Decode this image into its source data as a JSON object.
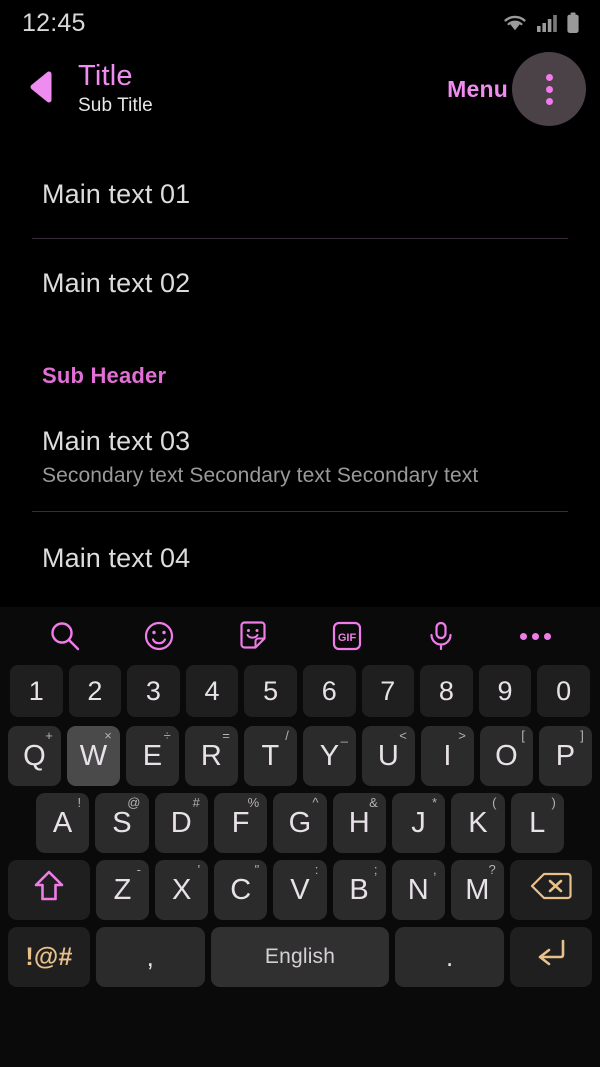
{
  "status_bar": {
    "time": "12:45",
    "icons": [
      "wifi-icon",
      "signal-icon",
      "battery-icon"
    ]
  },
  "app_bar": {
    "back_icon": "back-chevron-icon",
    "title": "Title",
    "subtitle": "Sub Title",
    "menu_label": "Menu",
    "overflow_icon": "overflow-menu-icon",
    "accent_color": "#ef8cef"
  },
  "content": {
    "rows": [
      {
        "main": "Main text 01",
        "secondary": ""
      },
      {
        "main": "Main text 02",
        "secondary": ""
      },
      {
        "main": "Main text 03",
        "secondary": "Secondary text Secondary text Secondary text"
      },
      {
        "main": "Main text 04",
        "secondary": ""
      }
    ],
    "sub_header": "Sub Header",
    "sub_header_color": "#e26fd6",
    "divider_color": "#3a2b3a"
  },
  "keyboard": {
    "toolbar": [
      {
        "name": "search-icon",
        "label": "Search"
      },
      {
        "name": "emoji-icon",
        "label": "Emoji"
      },
      {
        "name": "sticker-icon",
        "label": "Sticker"
      },
      {
        "name": "gif-icon",
        "label": "GIF"
      },
      {
        "name": "microphone-icon",
        "label": "Voice input"
      },
      {
        "name": "more-options-icon",
        "label": "More"
      }
    ],
    "gif_label": "GIF",
    "numbers": [
      "1",
      "2",
      "3",
      "4",
      "5",
      "6",
      "7",
      "8",
      "9",
      "0"
    ],
    "row_qwerty": [
      {
        "key": "Q",
        "alt": "+"
      },
      {
        "key": "W",
        "alt": "×",
        "pressed": true
      },
      {
        "key": "E",
        "alt": "÷"
      },
      {
        "key": "R",
        "alt": "="
      },
      {
        "key": "T",
        "alt": "/"
      },
      {
        "key": "Y",
        "alt": "_"
      },
      {
        "key": "U",
        "alt": "<"
      },
      {
        "key": "I",
        "alt": ">"
      },
      {
        "key": "O",
        "alt": "["
      },
      {
        "key": "P",
        "alt": "]"
      }
    ],
    "row_asdf": [
      {
        "key": "A",
        "alt": "!"
      },
      {
        "key": "S",
        "alt": "@"
      },
      {
        "key": "D",
        "alt": "#"
      },
      {
        "key": "F",
        "alt": "%"
      },
      {
        "key": "G",
        "alt": "^"
      },
      {
        "key": "H",
        "alt": "&"
      },
      {
        "key": "J",
        "alt": "*"
      },
      {
        "key": "K",
        "alt": "("
      },
      {
        "key": "L",
        "alt": ")"
      }
    ],
    "row_zxcv": [
      {
        "key": "Z",
        "alt": "-"
      },
      {
        "key": "X",
        "alt": "'"
      },
      {
        "key": "C",
        "alt": "\""
      },
      {
        "key": "V",
        "alt": ":"
      },
      {
        "key": "B",
        "alt": ";"
      },
      {
        "key": "N",
        "alt": ","
      },
      {
        "key": "M",
        "alt": "?"
      }
    ],
    "shift_icon": "shift-arrow-icon",
    "backspace_icon": "backspace-icon",
    "symbols_label": "!@#",
    "comma_label": ",",
    "space_label": "English",
    "period_label": ".",
    "enter_icon": "enter-arrow-icon",
    "key_accent_color": "#e8c08a",
    "shift_color": "#ef7ce8"
  }
}
